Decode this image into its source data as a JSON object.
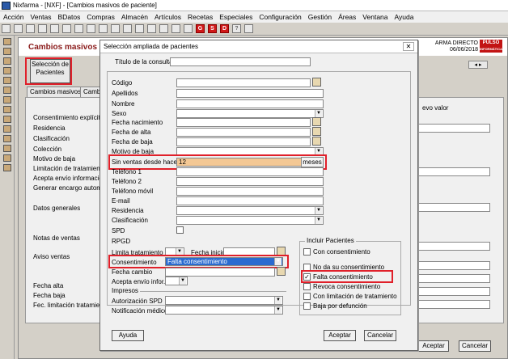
{
  "window": {
    "title": "Nixfarma - [NXF] - [Cambios masivos de paciente]"
  },
  "menu": [
    "Acción",
    "Ventas",
    "BDatos",
    "Compras",
    "Almacén",
    "Artículos",
    "Recetas",
    "Especiales",
    "Configuración",
    "Gestión",
    "Áreas",
    "Ventana",
    "Ayuda"
  ],
  "toolbar": {
    "g": "G",
    "s": "S",
    "d": "D",
    "q": "?"
  },
  "bg": {
    "title": "Cambios masivos d",
    "pharmacy": "ARMA DIRECTO",
    "date": "06/06/2018",
    "brand": "PULSO",
    "brand_sub": "INFORMÁTICA",
    "sel_button": "Selección de Pacientes",
    "tab1": "Cambios masivos",
    "tab2": "Cambi",
    "new_value": "evo valor",
    "labels": [
      "Consentimiento explícito",
      "Residencia",
      "Clasificación",
      "Colección",
      "Motivo de baja",
      "Limitación de tratamiento",
      "Acepta envío información",
      "Generar encargo automátic",
      "Datos generales",
      "Notas de ventas",
      "Aviso ventas",
      "Fecha alta",
      "Fecha baja",
      "Fec. limitación tratamiento"
    ],
    "accept": "Aceptar",
    "cancel": "Cancelar"
  },
  "dialog": {
    "title": "Selección ampliada de pacientes",
    "query_label": "Título de la consulta:",
    "fields": [
      "Código",
      "Apellidos",
      "Nombre",
      "Sexo",
      "Fecha nacimiento",
      "Fecha de alta",
      "Fecha de baja",
      "Motivo de baja",
      "Sin ventas desde hace",
      "Teléfono 1",
      "Teléfono 2",
      "Teléfono móvil",
      "E-mail",
      "Residencia",
      "Clasificación",
      "SPD",
      "RPGD"
    ],
    "sin_ventas_value": "12",
    "sin_ventas_unit": "meses",
    "limit_label": "Limita tratamiento",
    "fecha_inicio": "Fecha inicio",
    "consent_label": "Consentimiento",
    "consent_value": "Falta consentimiento",
    "fecha_cambio": "Fecha cambio",
    "acepta_envio": "Acepta envío infor.",
    "impresos": "Impresos",
    "autorizacion": "Autorización SPD",
    "notificacion": "Notificación médico",
    "incluir_title": "Incluir Pacientes",
    "incluir": [
      {
        "label": "Con consentimiento",
        "checked": false
      },
      {
        "label": "No da su consentimiento",
        "checked": false
      },
      {
        "label": "Falta consentimiento",
        "checked": true
      },
      {
        "label": "Revoca consentimiento",
        "checked": false
      },
      {
        "label": "Con limitación de tratamiento",
        "checked": false
      },
      {
        "label": "Baja por defunción",
        "checked": false
      }
    ],
    "help": "Ayuda",
    "accept": "Aceptar",
    "cancel": "Cancelar",
    "close": "✕"
  }
}
